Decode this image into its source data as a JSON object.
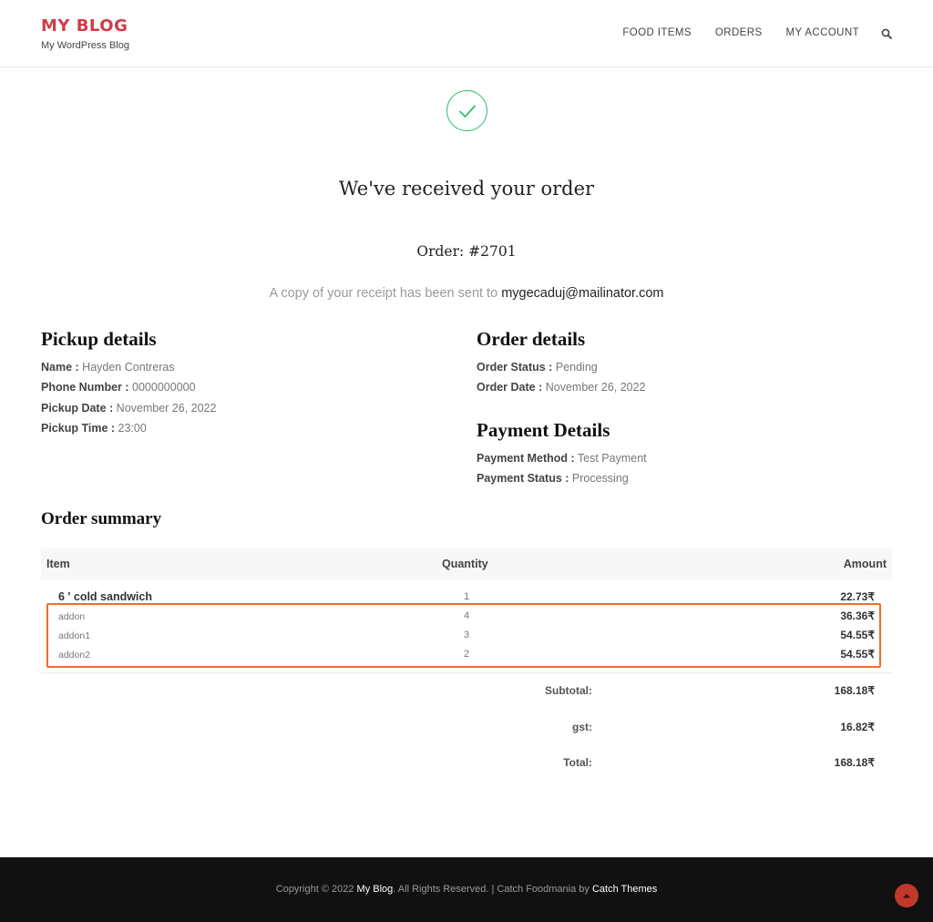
{
  "header": {
    "site_title": "MY BLOG",
    "tagline": "My WordPress Blog",
    "nav": [
      "FOOD ITEMS",
      "ORDERS",
      "MY ACCOUNT"
    ],
    "search_icon": "search-icon"
  },
  "confirmation": {
    "icon": "checkmark-icon",
    "heading": "We've received your order",
    "order_number": "Order: #2701",
    "receipt_prefix": "A copy of your receipt has been sent to",
    "email": "mygecaduj@mailinator.com",
    "accent_color": "#2fbf71"
  },
  "pickup": {
    "heading": "Pickup details",
    "name_label": "Name :",
    "name": "Hayden Contreras",
    "phone_label": "Phone Number :",
    "phone": "0000000000",
    "date_label": "Pickup Date :",
    "date": "November 26, 2022",
    "time_label": "Pickup Time :",
    "time": "23:00"
  },
  "order_details": {
    "heading": "Order details",
    "status_label": "Order Status :",
    "status": "Pending",
    "date_label": "Order Date :",
    "date": "November 26, 2022"
  },
  "payment": {
    "heading": "Payment Details",
    "method_label": "Payment Method :",
    "method": "Test Payment",
    "status_label": "Payment Status :",
    "status": "Processing"
  },
  "summary": {
    "heading": "Order summary",
    "columns": {
      "item": "Item",
      "quantity": "Quantity",
      "amount": "Amount"
    },
    "rows": [
      {
        "name": "6 ' cold sandwich",
        "qty": "1",
        "amount": "22.73₹"
      },
      {
        "name": "addon",
        "qty": "4",
        "amount": "36.36₹"
      },
      {
        "name": "addon1",
        "qty": "3",
        "amount": "54.55₹"
      },
      {
        "name": "addon2",
        "qty": "2",
        "amount": "54.55₹"
      }
    ],
    "subtotal_label": "Subtotal:",
    "subtotal": "168.18₹",
    "gst_label": "gst:",
    "gst": "16.82₹",
    "total_label": "Total:",
    "total": "168.18₹",
    "highlight_color": "#ef6c2e"
  },
  "footer": {
    "copyright": "Copyright © 2022",
    "site_link": "My Blog",
    "rights": ". All Rights Reserved. | Catch Foodmania by",
    "theme_link": "Catch Themes",
    "scroll_top_icon": "chevron-up-icon"
  }
}
